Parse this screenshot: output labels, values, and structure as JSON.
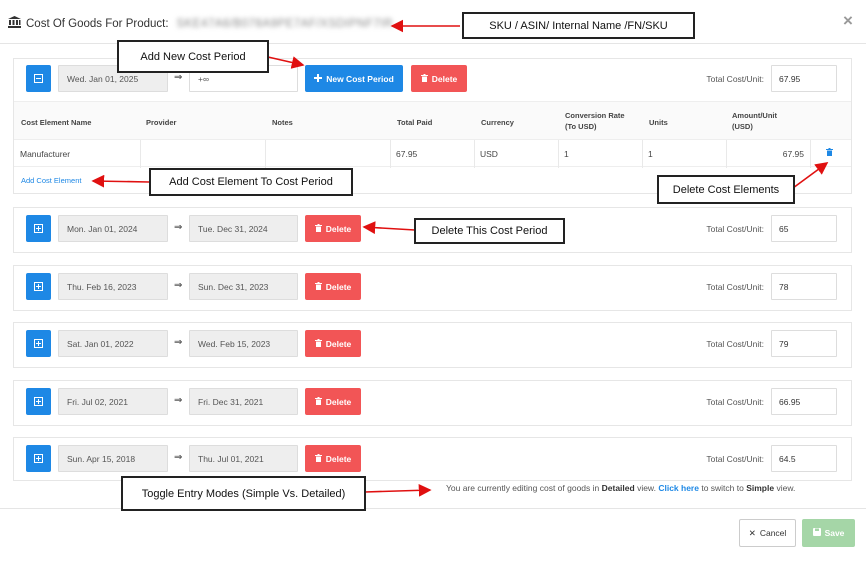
{
  "header": {
    "title": "Cost Of Goods For Product:",
    "sku_blurred": "SKE47A6/B078A9PE7AF/XSDIPNF7IR",
    "close": "×"
  },
  "icons": {
    "bank": "bank-icon",
    "minus": "collapse-icon",
    "plus": "expand-icon",
    "plus_btn": "plus-icon",
    "trash": "trash-icon",
    "times": "close-icon",
    "save": "save-icon"
  },
  "labels": {
    "arrow": "⇒",
    "new_cost_period": "New Cost Period",
    "delete": "Delete",
    "total_cost_unit": "Total Cost/Unit:",
    "add_cost_element": "Add Cost Element"
  },
  "active_period": {
    "start": "Wed. Jan 01, 2025",
    "end": "+∞",
    "total": "67.95"
  },
  "table": {
    "columns": [
      "Cost Element Name",
      "Provider",
      "Notes",
      "Total Paid",
      "Currency",
      "Conversion Rate",
      "(To USD)",
      "Units",
      "Amount/Unit",
      "(USD)"
    ],
    "rows": [
      {
        "name": "Manufacturer",
        "provider": "",
        "notes": "",
        "total_paid": "67.95",
        "currency": "USD",
        "conversion": "1",
        "units": "1",
        "amount": "67.95"
      }
    ]
  },
  "periods": [
    {
      "start": "Mon. Jan 01, 2024",
      "end": "Tue. Dec 31, 2024",
      "total": "65"
    },
    {
      "start": "Thu. Feb 16, 2023",
      "end": "Sun. Dec 31, 2023",
      "total": "78"
    },
    {
      "start": "Sat. Jan 01, 2022",
      "end": "Wed. Feb 15, 2023",
      "total": "79"
    },
    {
      "start": "Fri. Jul 02, 2021",
      "end": "Fri. Dec 31, 2021",
      "total": "66.95"
    },
    {
      "start": "Sun. Apr 15, 2018",
      "end": "Thu. Jul 01, 2021",
      "total": "64.5"
    }
  ],
  "callouts": {
    "sku": "SKU / ASIN/ Internal Name /FN/SKU",
    "add_period": "Add New Cost Period",
    "add_element": "Add Cost Element To Cost Period",
    "delete_elements": "Delete Cost Elements",
    "delete_period": "Delete This Cost Period",
    "toggle": "Toggle Entry Modes (Simple Vs. Detailed)"
  },
  "footer": {
    "text_a": "You are currently editing cost of goods in ",
    "mode": "Detailed",
    "text_b": " view. ",
    "link": "Click here",
    "text_c": " to switch to ",
    "other_mode": "Simple",
    "text_d": " view.",
    "cancel": "Cancel",
    "save": "Save"
  },
  "colors": {
    "primary": "#1e88e5",
    "danger": "#f25556",
    "success_disabled": "#a5d6a7",
    "annotation": "#e01010"
  }
}
